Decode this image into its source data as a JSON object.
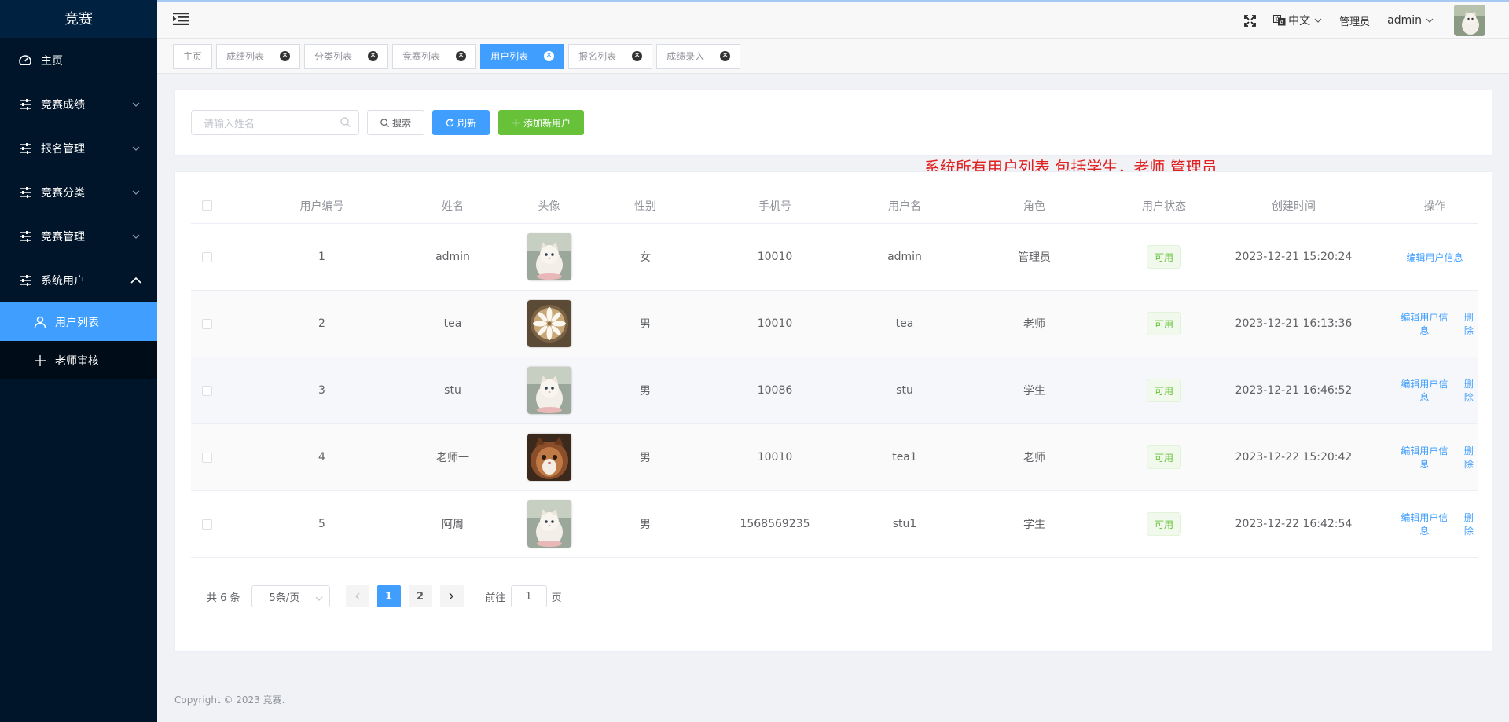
{
  "sidebar": {
    "title": "竞赛",
    "menu": [
      {
        "label": "主页",
        "icon": "dashboard-icon"
      },
      {
        "label": "竞赛成绩",
        "icon": "sliders-icon"
      },
      {
        "label": "报名管理",
        "icon": "sliders-icon"
      },
      {
        "label": "竞赛分类",
        "icon": "sliders-icon"
      },
      {
        "label": "竞赛管理",
        "icon": "sliders-icon"
      },
      {
        "label": "系统用户",
        "icon": "sliders-icon"
      }
    ],
    "submenu": [
      {
        "label": "用户列表",
        "icon": "user-icon",
        "active": true
      },
      {
        "label": "老师审核",
        "icon": "plus-icon",
        "active": false
      }
    ]
  },
  "topbar": {
    "language": "中文",
    "role": "管理员",
    "username": "admin"
  },
  "tags": [
    {
      "label": "主页",
      "closable": false,
      "active": false
    },
    {
      "label": "成绩列表",
      "closable": true,
      "active": false
    },
    {
      "label": "分类列表",
      "closable": true,
      "active": false
    },
    {
      "label": "竞赛列表",
      "closable": true,
      "active": false
    },
    {
      "label": "用户列表",
      "closable": true,
      "active": true
    },
    {
      "label": "报名列表",
      "closable": true,
      "active": false
    },
    {
      "label": "成绩录入",
      "closable": true,
      "active": false
    }
  ],
  "search": {
    "placeholder": "请输入姓名",
    "search_label": "搜索",
    "refresh_label": "刷新",
    "add_label": "添加新用户"
  },
  "annotation": "系统所有用户列表 包括学生，老师 管理员",
  "table": {
    "headers": [
      "用户编号",
      "姓名",
      "头像",
      "性别",
      "手机号",
      "用户名",
      "角色",
      "用户状态",
      "创建时间",
      "操作"
    ],
    "rows": [
      {
        "id": "1",
        "name": "admin",
        "avatar": "cat-white",
        "gender": "女",
        "phone": "10010",
        "username": "admin",
        "role": "管理员",
        "status": "可用",
        "created": "2023-12-21 15:20:24",
        "edit": "编辑用户信息",
        "delete": ""
      },
      {
        "id": "2",
        "name": "tea",
        "avatar": "coffee-flower",
        "gender": "男",
        "phone": "10010",
        "username": "tea",
        "role": "老师",
        "status": "可用",
        "created": "2023-12-21 16:13:36",
        "edit": "编辑用户信息",
        "delete": "删除"
      },
      {
        "id": "3",
        "name": "stu",
        "avatar": "cat-white",
        "gender": "男",
        "phone": "10086",
        "username": "stu",
        "role": "学生",
        "status": "可用",
        "created": "2023-12-21 16:46:52",
        "edit": "编辑用户信息",
        "delete": "删除"
      },
      {
        "id": "4",
        "name": "老师一",
        "avatar": "cat-brown",
        "gender": "男",
        "phone": "10010",
        "username": "tea1",
        "role": "老师",
        "status": "可用",
        "created": "2023-12-22 15:20:42",
        "edit": "编辑用户信息",
        "delete": "删除"
      },
      {
        "id": "5",
        "name": "阿周",
        "avatar": "cat-white",
        "gender": "男",
        "phone": "1568569235",
        "username": "stu1",
        "role": "学生",
        "status": "可用",
        "created": "2023-12-22 16:42:54",
        "edit": "编辑用户信息",
        "delete": "删除"
      }
    ]
  },
  "pagination": {
    "total": "共 6 条",
    "page_size": "5条/页",
    "pages": [
      "1",
      "2"
    ],
    "current": "1",
    "goto_prefix": "前往",
    "goto_value": "1",
    "goto_suffix": "页"
  },
  "footer": "Copyright © 2023 竞赛.",
  "colors": {
    "sidebar_bg": "#001529",
    "primary": "#409eff",
    "success": "#67c23a",
    "annotation": "#e02020"
  }
}
